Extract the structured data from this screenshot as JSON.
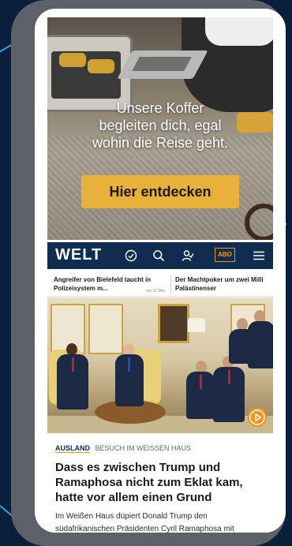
{
  "ad": {
    "headline_lines": [
      "Unsere Koffer",
      "begleiten dich, egal",
      "wohin die Reise geht."
    ],
    "cta_label": "Hier entdecken"
  },
  "header": {
    "logo": "WELT",
    "abo_label": "ABO",
    "icons": [
      "clock-icon",
      "search-icon",
      "user-icon",
      "menu-icon"
    ]
  },
  "ticker": [
    {
      "title_lines": [
        "Angreifer von Bielefeld taucht in",
        "Polizeisystem m..."
      ],
      "time": "vor 10 Min."
    },
    {
      "title_lines": [
        "Der Machtpoker um zwei Milli",
        "Palästinenser"
      ],
      "time": ""
    }
  ],
  "article": {
    "ressort": "AUSLAND",
    "topic": "BESUCH IM WEISSEN HAUS",
    "title_lines": [
      "Dass es zwischen Trump und",
      "Ramaphosa nicht zum Eklat kam,",
      "hatte vor allem einen Grund"
    ],
    "teaser_lines": [
      "Im Weißen Haus düpiert Donald Trump den",
      "südafrikanischen Präsidenten Cyril Ramaphosa mit"
    ]
  },
  "colors": {
    "brand_navy": "#0f2e4f",
    "accent_orange": "#f6921e",
    "cta_yellow": "#e8b13a",
    "phone_frame": "#5d6168",
    "background": "#0a1f3c"
  }
}
